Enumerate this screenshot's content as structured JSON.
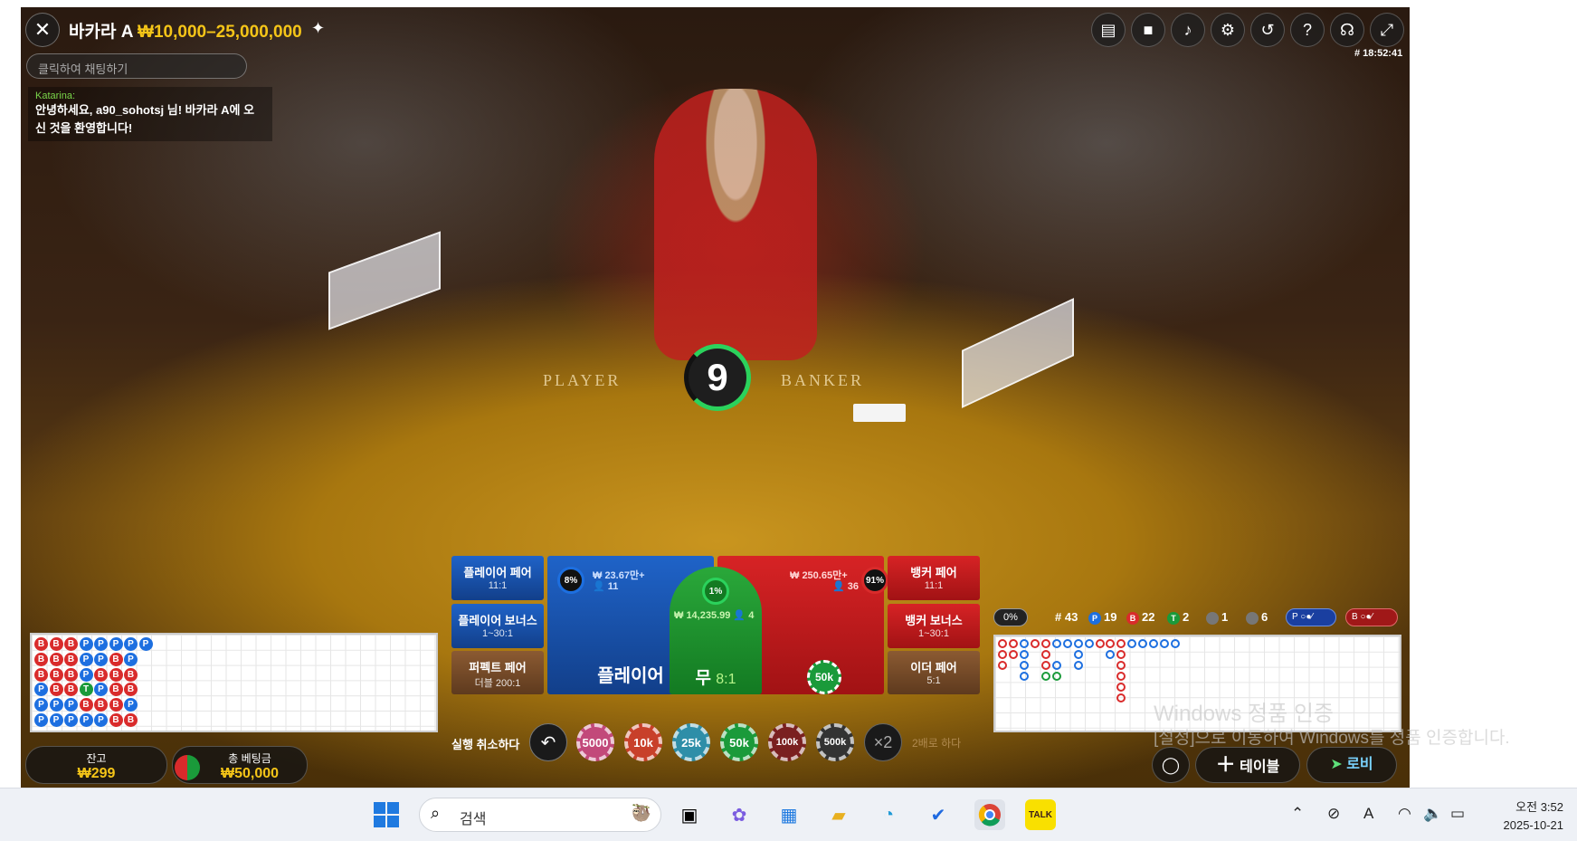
{
  "header": {
    "title": "바카라 A",
    "limit": "₩10,000–25,000,000",
    "clock": "# 18:52:41"
  },
  "chat": {
    "placeholder": "클릭하여 채팅하기",
    "user": "Katarina:",
    "message": "안녕하세요, a90_sohotsj 님! 바카라 A에 오신 것을 환영합니다!"
  },
  "table": {
    "player_text": "PLAYER",
    "banker_text": "BANKER",
    "countdown": "9"
  },
  "bets": {
    "player_pair": {
      "label": "플레이어 페어",
      "odds": "11:1"
    },
    "player_bonus": {
      "label": "플레이어 보너스",
      "odds": "1~30:1"
    },
    "perfect_pair": {
      "label": "퍼펙트 페어",
      "odds": "더블 200:1"
    },
    "player": {
      "label": "플레이어",
      "percent": "8%",
      "amount": "₩ 23.67만+",
      "players": "11"
    },
    "tie": {
      "label": "무",
      "odds": "8:1",
      "percent": "1%",
      "amount": "₩ 14,235.99",
      "players": "4"
    },
    "banker": {
      "percent": "91%",
      "amount": "₩ 250.65만+",
      "players": "36",
      "chip": "50k"
    },
    "banker_pair": {
      "label": "뱅커 페어",
      "odds": "11:1"
    },
    "banker_bonus": {
      "label": "뱅커 보너스",
      "odds": "1~30:1"
    },
    "either_pair": {
      "label": "이더 페어",
      "odds": "5:1"
    }
  },
  "controls": {
    "undo_label": "실행 취소하다",
    "chips": [
      "5000",
      "10k",
      "25k",
      "50k",
      "100k",
      "500k"
    ],
    "double_symbol": "×2",
    "double_label": "2배로 하다"
  },
  "balance": {
    "label": "잔고",
    "value": "₩299"
  },
  "total_bet": {
    "label": "총 베팅금",
    "value": "₩50,000"
  },
  "stats": {
    "percent": "0%",
    "round": "# 43",
    "player_wins": "19",
    "banker_wins": "22",
    "ties": "2",
    "player_pairs": "1",
    "banker_pairs": "6",
    "p_letter": "P",
    "b_letter": "B",
    "t_letter": "T"
  },
  "bead_road": [
    [
      "B",
      "B",
      "B",
      "P",
      "P",
      "P",
      "P",
      "P"
    ],
    [
      "B",
      "B",
      "B",
      "P",
      "P",
      "B",
      "P"
    ],
    [
      "B",
      "B",
      "B",
      "P",
      "B",
      "B",
      "B"
    ],
    [
      "P",
      "B",
      "B",
      "T",
      "P",
      "B",
      "B"
    ],
    [
      "P",
      "P",
      "P",
      "B",
      "B",
      "B",
      "P"
    ],
    [
      "P",
      "P",
      "P",
      "P",
      "P",
      "B",
      "B"
    ]
  ],
  "bottom_buttons": {
    "table": "테이블",
    "lobby": "로비"
  },
  "watermark": {
    "line1": "Windows 정품 인증",
    "line2": "[설정]으로 이동하여 Windows를 정품 인증합니다."
  },
  "taskbar": {
    "search": "검색",
    "time": "오전 3:52",
    "date": "2025-10-21",
    "ime": "A"
  },
  "colors": {
    "player": "#1d6fe0",
    "banker": "#d92b2b",
    "tie": "#1a9a3a",
    "limit": "#f5c518"
  }
}
